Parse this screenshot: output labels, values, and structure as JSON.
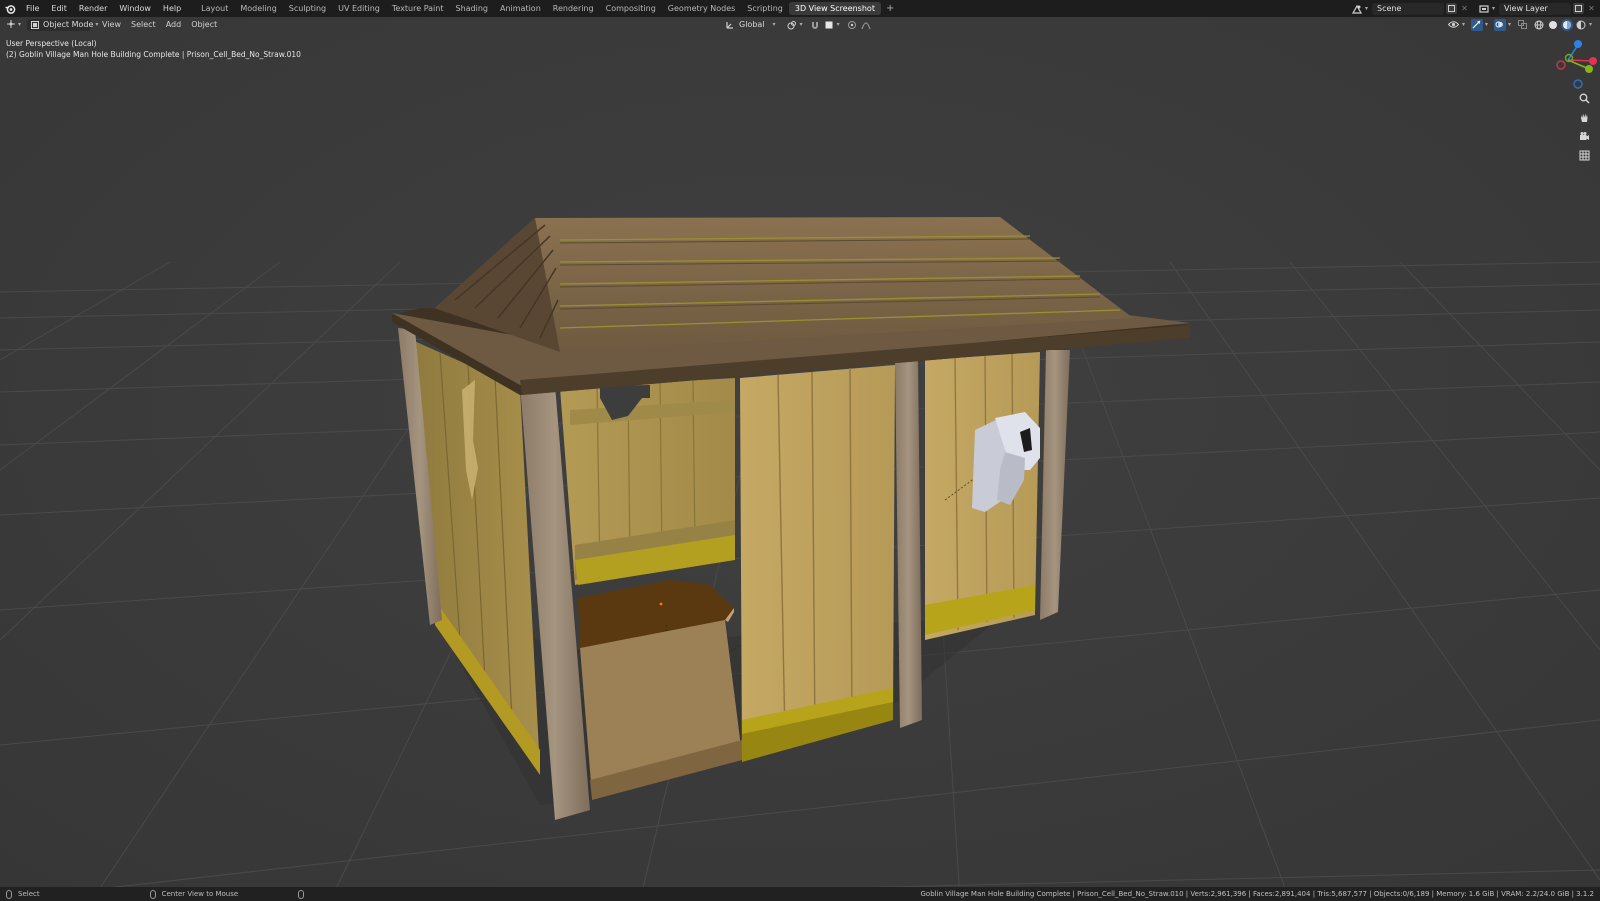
{
  "menubar": {
    "items": [
      "File",
      "Edit",
      "Render",
      "Window",
      "Help"
    ],
    "workspaces": [
      "Layout",
      "Modeling",
      "Sculpting",
      "UV Editing",
      "Texture Paint",
      "Shading",
      "Animation",
      "Rendering",
      "Compositing",
      "Geometry Nodes",
      "Scripting",
      "3D View Screenshot"
    ],
    "active_workspace": "3D View Screenshot",
    "add_tab": "+",
    "scene": "Scene",
    "view_layer": "View Layer"
  },
  "viewport_header": {
    "mode": "Object Mode",
    "menus": [
      "View",
      "Select",
      "Add",
      "Object"
    ],
    "transform_orientation": "Global"
  },
  "viewport": {
    "perspective_label": "User Perspective (Local)",
    "object_label": "(2) Goblin Village Man Hole Building Complete | Prison_Cell_Bed_No_Straw.010"
  },
  "gizmo": {
    "axes": [
      "X",
      "Y",
      "Z"
    ],
    "colors": {
      "x": "#e4334f",
      "y": "#86b41c",
      "z": "#2d82e4"
    }
  },
  "statusbar": {
    "left_action": "Select",
    "middle_action": "Center View to Mouse",
    "stats": "Goblin Village Man Hole Building Complete | Prison_Cell_Bed_No_Straw.010 | Verts:2,961,396 | Faces:2,891,404 | Tris:5,687,577 | Objects:0/6,189 | Memory: 1.6 GiB | VRAM: 2.2/24.0 GiB | 3.1.2"
  },
  "icons": {
    "app": "blender-logo-icon",
    "editor": "3d-viewport-icon",
    "mode": "object-mode-icon",
    "pivot": "pivot-icon",
    "snap": "snap-magnet-icon",
    "proportional": "proportional-edit-icon",
    "nav": [
      "zoom-icon",
      "pan-hand-icon",
      "camera-icon",
      "grid-view-icon"
    ]
  }
}
